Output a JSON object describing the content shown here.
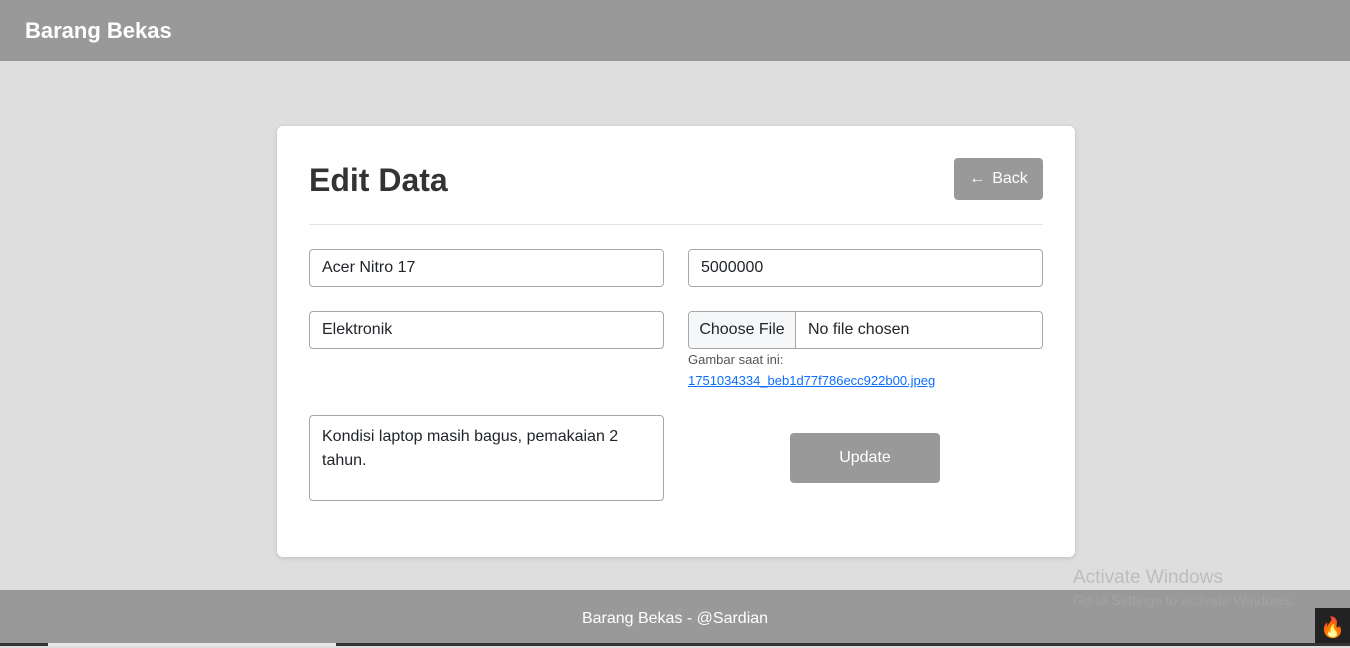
{
  "navbar": {
    "brand": "Barang Bekas"
  },
  "card": {
    "title": "Edit Data",
    "back_label": "Back",
    "fields": {
      "name": "Acer Nitro 17",
      "price": "5000000",
      "category": "Elektronik",
      "description": "Kondisi laptop masih bagus, pemakaian 2 tahun.",
      "file_button": "Choose File",
      "file_status": "No file chosen",
      "current_image_label": "Gambar saat ini:",
      "current_image_link": "1751034334_beb1d77f786ecc922b00.jpeg"
    },
    "update_label": "Update"
  },
  "footer": {
    "text": "Barang Bekas - @Sardian"
  },
  "watermark": {
    "title": "Activate Windows",
    "subtitle": "Go to Settings to activate Windows."
  }
}
